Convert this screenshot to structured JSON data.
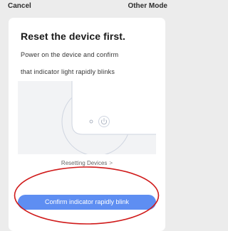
{
  "nav": {
    "cancel_label": "Cancel",
    "other_mode_label": "Other Mode"
  },
  "content": {
    "title": "Reset the device first.",
    "description_line1": "Power on the device and confirm",
    "description_line2": "that indicator light rapidly blinks",
    "reset_link_label": "Resetting Devices",
    "reset_link_chevron": ">"
  },
  "action": {
    "confirm_label": "Confirm indicator rapidly blink"
  },
  "colors": {
    "background": "#ececec",
    "card": "#ffffff",
    "button": "#5e8ef2",
    "annotation": "#d01a1a"
  },
  "icons": {
    "device": "device-icon",
    "power": "power-icon",
    "indicator": "indicator-light-icon",
    "chevron": "chevron-right-icon"
  }
}
